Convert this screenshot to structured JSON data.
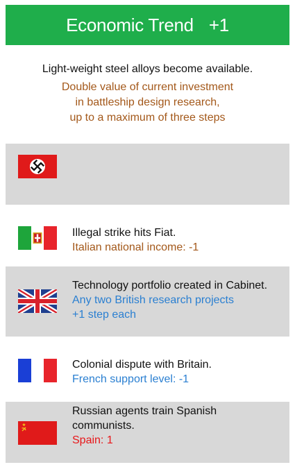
{
  "header": {
    "title": "Economic Trend",
    "value": "+1"
  },
  "trend": {
    "description": "Light-weight steel alloys become available.",
    "effect_lines": [
      "Double value of current investment",
      "in battleship design research,",
      "up to a maximum of three steps"
    ]
  },
  "events": [
    {
      "nation": "Germany",
      "flag_icon": "german-flag-icon",
      "description": "",
      "effect": ""
    },
    {
      "nation": "Italy",
      "flag_icon": "italian-flag-icon",
      "description": "Illegal strike hits Fiat.",
      "effect": "Italian national income: -1"
    },
    {
      "nation": "Britain",
      "flag_icon": "british-flag-icon",
      "description": "Technology portfolio created in Cabinet.",
      "effect_lines": [
        "Any two British research projects",
        "+1 step each"
      ]
    },
    {
      "nation": "France",
      "flag_icon": "french-flag-icon",
      "description": "Colonial dispute with Britain.",
      "effect": "French support level: -1"
    },
    {
      "nation": "Soviet Union",
      "flag_icon": "soviet-flag-icon",
      "description_lines": [
        "Russian agents train Spanish",
        "communists."
      ],
      "effect": "Spain: 1"
    }
  ],
  "colors": {
    "header_bg": "#1fae4b",
    "row_gray": "#d8d8d8",
    "effect_brown": "#a3581a",
    "effect_blue": "#2a7fd1",
    "effect_red": "#e8171a"
  }
}
